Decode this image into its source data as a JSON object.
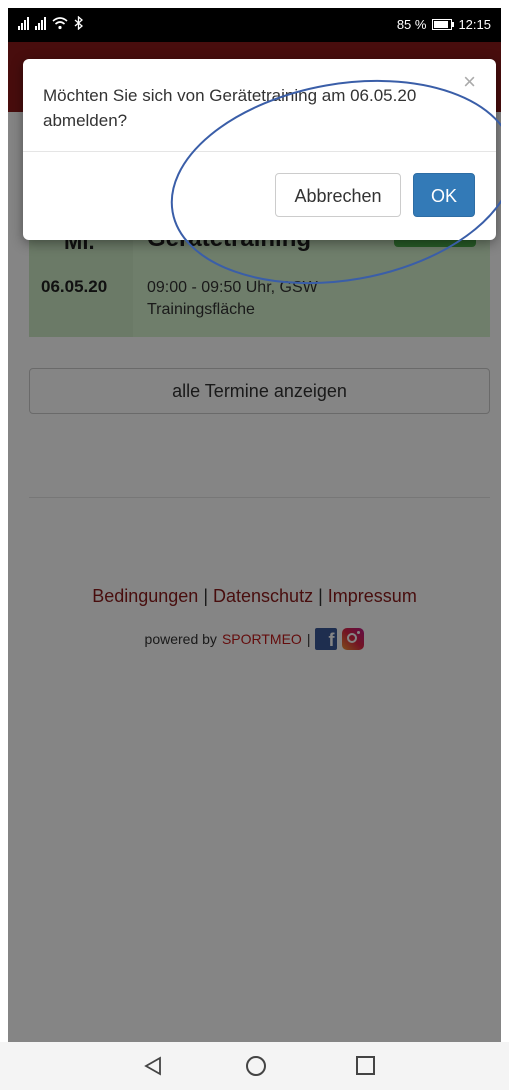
{
  "status_bar": {
    "battery_percent": "85 %",
    "time": "12:15"
  },
  "event": {
    "day": "Mi.",
    "date": "06.05.20",
    "title": "Gerätetraining",
    "time_location": "09:00 - 09:50 Uhr, GSW",
    "area": "Trainingsfläche"
  },
  "all_dates_button": "alle Termine anzeigen",
  "footer": {
    "link_terms": "Bedingungen",
    "link_privacy": "Datenschutz",
    "link_imprint": "Impressum",
    "separator": "|",
    "powered_by": "powered by",
    "brand": "SPORTMEO",
    "facebook_icon": "f"
  },
  "dialog": {
    "message": "Möchten Sie sich von Gerätetraining am 06.05.20 abmelden?",
    "close_glyph": "×",
    "cancel_label": "Abbrechen",
    "ok_label": "OK"
  },
  "colors": {
    "brand_red": "#8b1a1a",
    "ok_blue": "#337ab7",
    "event_green": "#d5f2cd",
    "annotation_blue": "#3a5ea8"
  },
  "icons": [
    "signal-icon",
    "wifi-icon",
    "bluetooth-icon",
    "battery-icon",
    "close-icon",
    "facebook-icon",
    "instagram-icon",
    "back-icon",
    "home-icon",
    "recent-apps-icon"
  ]
}
